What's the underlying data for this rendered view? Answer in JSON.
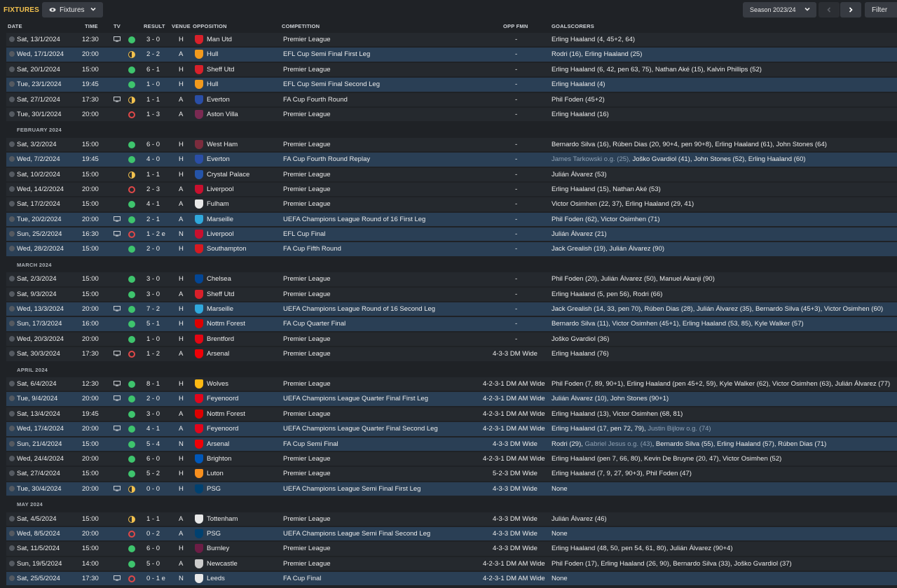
{
  "topbar": {
    "title": "FIXTURES",
    "view_label": "Fixtures",
    "season_label": "Season 2023/24",
    "filter_label": "Filter"
  },
  "columns": {
    "date": "DATE",
    "time": "TIME",
    "tv": "TV",
    "result": "RESULT",
    "venue": "VENUE",
    "opposition": "OPPOSITION",
    "competition": "COMPETITION",
    "opp_fmn": "OPP FMN",
    "goalscorers": "GOALSCORERS"
  },
  "colors": {
    "win": "#3ec46d",
    "draw": "#f2c14e",
    "loss": "#e04848",
    "accent": "#f2c14e",
    "highlight_row": "#2a3f55"
  },
  "rows": [
    {
      "kind": "match",
      "date": "Sat, 13/1/2024",
      "time": "12:30",
      "tv": true,
      "outcome": "win",
      "result": "3 - 0",
      "venue": "H",
      "opp": "Man Utd",
      "crest": "#d8202a",
      "comp": "Premier League",
      "fmn": "-",
      "scorers": "Erling Haaland (4, 45+2, 64)",
      "hl": false
    },
    {
      "kind": "match",
      "date": "Wed, 17/1/2024",
      "time": "20:00",
      "tv": false,
      "outcome": "draw",
      "result": "2 - 2",
      "venue": "A",
      "opp": "Hull",
      "crest": "#f29a1d",
      "comp": "EFL Cup Semi Final First Leg",
      "fmn": "-",
      "scorers": "Rodri (16), Erling Haaland (25)",
      "hl": true
    },
    {
      "kind": "match",
      "date": "Sat, 20/1/2024",
      "time": "15:00",
      "tv": false,
      "outcome": "win",
      "result": "6 - 1",
      "venue": "H",
      "opp": "Sheff Utd",
      "crest": "#d8202a",
      "comp": "Premier League",
      "fmn": "-",
      "scorers": "Erling Haaland (6, 42, pen 63, 75), Nathan Aké (15), Kalvin Phillips (52)",
      "hl": false
    },
    {
      "kind": "match",
      "date": "Tue, 23/1/2024",
      "time": "19:45",
      "tv": false,
      "outcome": "win",
      "result": "1 - 0",
      "venue": "H",
      "opp": "Hull",
      "crest": "#f29a1d",
      "comp": "EFL Cup Semi Final Second Leg",
      "fmn": "-",
      "scorers": "Erling Haaland (4)",
      "hl": true
    },
    {
      "kind": "match",
      "date": "Sat, 27/1/2024",
      "time": "17:30",
      "tv": true,
      "outcome": "draw",
      "result": "1 - 1",
      "venue": "A",
      "opp": "Everton",
      "crest": "#2a4ea6",
      "comp": "FA Cup Fourth Round",
      "fmn": "-",
      "scorers": "Phil Foden (45+2)",
      "hl": false
    },
    {
      "kind": "match",
      "date": "Tue, 30/1/2024",
      "time": "20:00",
      "tv": false,
      "outcome": "loss",
      "result": "1 - 3",
      "venue": "A",
      "opp": "Aston Villa",
      "crest": "#7a2a52",
      "comp": "Premier League",
      "fmn": "-",
      "scorers": "Erling Haaland (16)",
      "hl": false
    },
    {
      "kind": "month",
      "label": "FEBRUARY 2024"
    },
    {
      "kind": "match",
      "date": "Sat, 3/2/2024",
      "time": "15:00",
      "tv": false,
      "outcome": "win",
      "result": "6 - 0",
      "venue": "H",
      "opp": "West Ham",
      "crest": "#7b2c3d",
      "comp": "Premier League",
      "fmn": "-",
      "scorers": "Bernardo Silva (16), Rúben Dias (20, 90+4, pen 90+8), Erling Haaland (61), John Stones (64)",
      "hl": false
    },
    {
      "kind": "match",
      "date": "Wed, 7/2/2024",
      "time": "19:45",
      "tv": false,
      "outcome": "win",
      "result": "4 - 0",
      "venue": "H",
      "opp": "Everton",
      "crest": "#2a4ea6",
      "comp": "FA Cup Fourth Round Replay",
      "fmn": "-",
      "scorers_og": "James Tarkowski o.g. (25), ",
      "scorers": "Joško Gvardiol (41), John Stones (52), Erling Haaland (60)",
      "hl": true
    },
    {
      "kind": "match",
      "date": "Sat, 10/2/2024",
      "time": "15:00",
      "tv": false,
      "outcome": "draw",
      "result": "1 - 1",
      "venue": "H",
      "opp": "Crystal Palace",
      "crest": "#2554a8",
      "comp": "Premier League",
      "fmn": "-",
      "scorers": "Julián Álvarez (53)",
      "hl": false
    },
    {
      "kind": "match",
      "date": "Wed, 14/2/2024",
      "time": "20:00",
      "tv": false,
      "outcome": "loss",
      "result": "2 - 3",
      "venue": "A",
      "opp": "Liverpool",
      "crest": "#c8102e",
      "comp": "Premier League",
      "fmn": "-",
      "scorers": "Erling Haaland (15), Nathan Aké (53)",
      "hl": false
    },
    {
      "kind": "match",
      "date": "Sat, 17/2/2024",
      "time": "15:00",
      "tv": false,
      "outcome": "win",
      "result": "4 - 1",
      "venue": "A",
      "opp": "Fulham",
      "crest": "#e8e8e8",
      "comp": "Premier League",
      "fmn": "-",
      "scorers": "Victor Osimhen (22, 37), Erling Haaland (29, 41)",
      "hl": false
    },
    {
      "kind": "match",
      "date": "Tue, 20/2/2024",
      "time": "20:00",
      "tv": true,
      "outcome": "win",
      "result": "2 - 1",
      "venue": "A",
      "opp": "Marseille",
      "crest": "#2fa8dc",
      "comp": "UEFA Champions League Round of 16 First Leg",
      "fmn": "-",
      "scorers": "Phil Foden (62), Victor Osimhen (71)",
      "hl": true
    },
    {
      "kind": "match",
      "date": "Sun, 25/2/2024",
      "time": "16:30",
      "tv": true,
      "outcome": "loss",
      "result": "1 - 2 e",
      "venue": "N",
      "opp": "Liverpool",
      "crest": "#c8102e",
      "comp": "EFL Cup Final",
      "fmn": "-",
      "scorers": "Julián Álvarez (21)",
      "hl": true
    },
    {
      "kind": "match",
      "date": "Wed, 28/2/2024",
      "time": "15:00",
      "tv": false,
      "outcome": "win",
      "result": "2 - 0",
      "venue": "H",
      "opp": "Southampton",
      "crest": "#d71920",
      "comp": "FA Cup Fifth Round",
      "fmn": "-",
      "scorers": "Jack Grealish (19), Julián Álvarez (90)",
      "hl": true
    },
    {
      "kind": "month",
      "label": "MARCH 2024"
    },
    {
      "kind": "match",
      "date": "Sat, 2/3/2024",
      "time": "15:00",
      "tv": false,
      "outcome": "win",
      "result": "3 - 0",
      "venue": "H",
      "opp": "Chelsea",
      "crest": "#034694",
      "comp": "Premier League",
      "fmn": "-",
      "scorers": "Phil Foden (20), Julián Álvarez (50), Manuel Akanji (90)",
      "hl": false
    },
    {
      "kind": "match",
      "date": "Sat, 9/3/2024",
      "time": "15:00",
      "tv": false,
      "outcome": "win",
      "result": "3 - 0",
      "venue": "A",
      "opp": "Sheff Utd",
      "crest": "#d8202a",
      "comp": "Premier League",
      "fmn": "-",
      "scorers": "Erling Haaland (5, pen 56), Rodri (66)",
      "hl": false
    },
    {
      "kind": "match",
      "date": "Wed, 13/3/2024",
      "time": "20:00",
      "tv": true,
      "outcome": "win",
      "result": "7 - 2",
      "venue": "H",
      "opp": "Marseille",
      "crest": "#2fa8dc",
      "comp": "UEFA Champions League Round of 16 Second Leg",
      "fmn": "-",
      "scorers": "Jack Grealish (14, 33, pen 70), Rúben Dias (28), Julián Álvarez (35), Bernardo Silva (45+3), Victor Osimhen (60)",
      "hl": true
    },
    {
      "kind": "match",
      "date": "Sun, 17/3/2024",
      "time": "16:00",
      "tv": false,
      "outcome": "win",
      "result": "5 - 1",
      "venue": "H",
      "opp": "Nottm Forest",
      "crest": "#dd0000",
      "comp": "FA Cup Quarter Final",
      "fmn": "-",
      "scorers": "Bernardo Silva (11), Victor Osimhen (45+1), Erling Haaland (53, 85), Kyle Walker (57)",
      "hl": true
    },
    {
      "kind": "match",
      "date": "Wed, 20/3/2024",
      "time": "20:00",
      "tv": false,
      "outcome": "win",
      "result": "1 - 0",
      "venue": "H",
      "opp": "Brentford",
      "crest": "#e30613",
      "comp": "Premier League",
      "fmn": "-",
      "scorers": "Joško Gvardiol (36)",
      "hl": false
    },
    {
      "kind": "match",
      "date": "Sat, 30/3/2024",
      "time": "17:30",
      "tv": true,
      "outcome": "loss",
      "result": "1 - 2",
      "venue": "A",
      "opp": "Arsenal",
      "crest": "#ef0107",
      "comp": "Premier League",
      "fmn": "4-3-3 DM Wide",
      "scorers": "Erling Haaland (76)",
      "hl": false
    },
    {
      "kind": "month",
      "label": "APRIL 2024"
    },
    {
      "kind": "match",
      "date": "Sat, 6/4/2024",
      "time": "12:30",
      "tv": true,
      "outcome": "win",
      "result": "8 - 1",
      "venue": "H",
      "opp": "Wolves",
      "crest": "#fdb913",
      "comp": "Premier League",
      "fmn": "4-2-3-1 DM AM Wide",
      "scorers": "Phil Foden (7, 89, 90+1), Erling Haaland (pen 45+2, 59), Kyle Walker (62), Victor Osimhen (63), Julián Álvarez (77)",
      "hl": false
    },
    {
      "kind": "match",
      "date": "Tue, 9/4/2024",
      "time": "20:00",
      "tv": true,
      "outcome": "win",
      "result": "2 - 0",
      "venue": "H",
      "opp": "Feyenoord",
      "crest": "#e3051b",
      "comp": "UEFA Champions League Quarter Final First Leg",
      "fmn": "4-2-3-1 DM AM Wide",
      "scorers": "Julián Álvarez (10), John Stones (90+1)",
      "hl": true
    },
    {
      "kind": "match",
      "date": "Sat, 13/4/2024",
      "time": "19:45",
      "tv": false,
      "outcome": "win",
      "result": "3 - 0",
      "venue": "A",
      "opp": "Nottm Forest",
      "crest": "#dd0000",
      "comp": "Premier League",
      "fmn": "4-2-3-1 DM AM Wide",
      "scorers": "Erling Haaland (13), Victor Osimhen (68, 81)",
      "hl": false
    },
    {
      "kind": "match",
      "date": "Wed, 17/4/2024",
      "time": "20:00",
      "tv": true,
      "outcome": "win",
      "result": "4 - 1",
      "venue": "A",
      "opp": "Feyenoord",
      "crest": "#e3051b",
      "comp": "UEFA Champions League Quarter Final Second Leg",
      "fmn": "4-2-3-1 DM AM Wide",
      "scorers": "Erling Haaland (17, pen 72, 79), ",
      "scorers_og_after": "Justin Bijlow o.g. (74)",
      "hl": true
    },
    {
      "kind": "match",
      "date": "Sun, 21/4/2024",
      "time": "15:00",
      "tv": false,
      "outcome": "win",
      "result": "5 - 4",
      "venue": "N",
      "opp": "Arsenal",
      "crest": "#ef0107",
      "comp": "FA Cup Semi Final",
      "fmn": "4-3-3 DM Wide",
      "scorers": "Rodri (29), ",
      "scorers_og_after": "Gabriel Jesus o.g. (43)",
      "scorers_tail": ", Bernardo Silva (55), Erling Haaland (57), Rúben Dias (71)",
      "hl": true
    },
    {
      "kind": "match",
      "date": "Wed, 24/4/2024",
      "time": "20:00",
      "tv": false,
      "outcome": "win",
      "result": "6 - 0",
      "venue": "H",
      "opp": "Brighton",
      "crest": "#0057b8",
      "comp": "Premier League",
      "fmn": "4-2-3-1 DM AM Wide",
      "scorers": "Erling Haaland (pen 7, 66, 80), Kevin De Bruyne (20, 47), Victor Osimhen (52)",
      "hl": false
    },
    {
      "kind": "match",
      "date": "Sat, 27/4/2024",
      "time": "15:00",
      "tv": false,
      "outcome": "win",
      "result": "5 - 2",
      "venue": "H",
      "opp": "Luton",
      "crest": "#f78f1e",
      "comp": "Premier League",
      "fmn": "5-2-3 DM Wide",
      "scorers": "Erling Haaland (7, 9, 27, 90+3), Phil Foden (47)",
      "hl": false
    },
    {
      "kind": "match",
      "date": "Tue, 30/4/2024",
      "time": "20:00",
      "tv": true,
      "outcome": "draw",
      "result": "0 - 0",
      "venue": "H",
      "opp": "PSG",
      "crest": "#004170",
      "comp": "UEFA Champions League Semi Final First Leg",
      "fmn": "4-3-3 DM Wide",
      "scorers": "None",
      "hl": true
    },
    {
      "kind": "month",
      "label": "MAY 2024"
    },
    {
      "kind": "match",
      "date": "Sat, 4/5/2024",
      "time": "15:00",
      "tv": false,
      "outcome": "draw",
      "result": "1 - 1",
      "venue": "A",
      "opp": "Tottenham",
      "crest": "#e8e8e8",
      "comp": "Premier League",
      "fmn": "4-3-3 DM Wide",
      "scorers": "Julián Álvarez (46)",
      "hl": false
    },
    {
      "kind": "match",
      "date": "Wed, 8/5/2024",
      "time": "20:00",
      "tv": false,
      "outcome": "loss",
      "result": "0 - 2",
      "venue": "A",
      "opp": "PSG",
      "crest": "#004170",
      "comp": "UEFA Champions League Semi Final Second Leg",
      "fmn": "4-3-3 DM Wide",
      "scorers": "None",
      "hl": true
    },
    {
      "kind": "match",
      "date": "Sat, 11/5/2024",
      "time": "15:00",
      "tv": false,
      "outcome": "win",
      "result": "6 - 0",
      "venue": "H",
      "opp": "Burnley",
      "crest": "#6c1d45",
      "comp": "Premier League",
      "fmn": "4-3-3 DM Wide",
      "scorers": "Erling Haaland (48, 50, pen 54, 61, 80), Julián Álvarez (90+4)",
      "hl": false
    },
    {
      "kind": "match",
      "date": "Sun, 19/5/2024",
      "time": "14:00",
      "tv": false,
      "outcome": "win",
      "result": "5 - 0",
      "venue": "A",
      "opp": "Newcastle",
      "crest": "#cccccc",
      "comp": "Premier League",
      "fmn": "4-2-3-1 DM AM Wide",
      "scorers": "Phil Foden (17), Erling Haaland (26, 90), Bernardo Silva (33), Joško Gvardiol (37)",
      "hl": false
    },
    {
      "kind": "match",
      "date": "Sat, 25/5/2024",
      "time": "17:30",
      "tv": true,
      "outcome": "loss",
      "result": "0 - 1 e",
      "venue": "N",
      "opp": "Leeds",
      "crest": "#e8e8e8",
      "comp": "FA Cup Final",
      "fmn": "4-2-3-1 DM AM Wide",
      "scorers": "None",
      "hl": true
    }
  ]
}
